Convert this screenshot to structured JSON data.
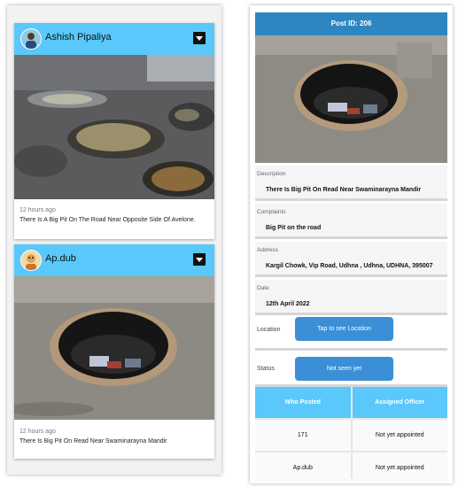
{
  "feed": {
    "posts": [
      {
        "author": "Ashish Pipaliya",
        "time": "12 hours ago",
        "description": "There Is A Big Pit On The Road Near Opposite Side Of Avelone.",
        "avatar_icon": "user-avatar-icon",
        "menu_icon": "dropdown-icon"
      },
      {
        "author": "Ap.dub",
        "time": "12 hours ago",
        "description": "There Is Big Pit On Read Near Swaminarayna Mandir",
        "avatar_icon": "user-avatar-icon",
        "menu_icon": "dropdown-icon"
      }
    ]
  },
  "detail": {
    "header": "Post ID: 206",
    "fields": {
      "description": {
        "label": "Description",
        "value": "There Is Big Pit On Read Near Swaminarayna Mandir"
      },
      "complaints": {
        "label": "Complaints",
        "value": "Big Pit on the road"
      },
      "address": {
        "label": "Address",
        "value": "Kargil Chowk, Vip Road, Udhna , Udhna, UDHNA, 395007"
      },
      "date": {
        "label": "Date",
        "value": "12th April 2022"
      }
    },
    "location": {
      "label": "Location",
      "button": "Tap to see Location"
    },
    "status": {
      "label": "Status",
      "button": "Not seen yet"
    },
    "table": {
      "headers": [
        "Who Posted",
        "Assigned Officer"
      ],
      "rows": [
        [
          "171",
          "Not yet appointed"
        ],
        [
          "Ap.dub",
          "Not yet appointed"
        ]
      ]
    }
  },
  "colors": {
    "card_header": "#5ac8fa",
    "post_header": "#2e86c1",
    "button": "#3a8fd6"
  }
}
